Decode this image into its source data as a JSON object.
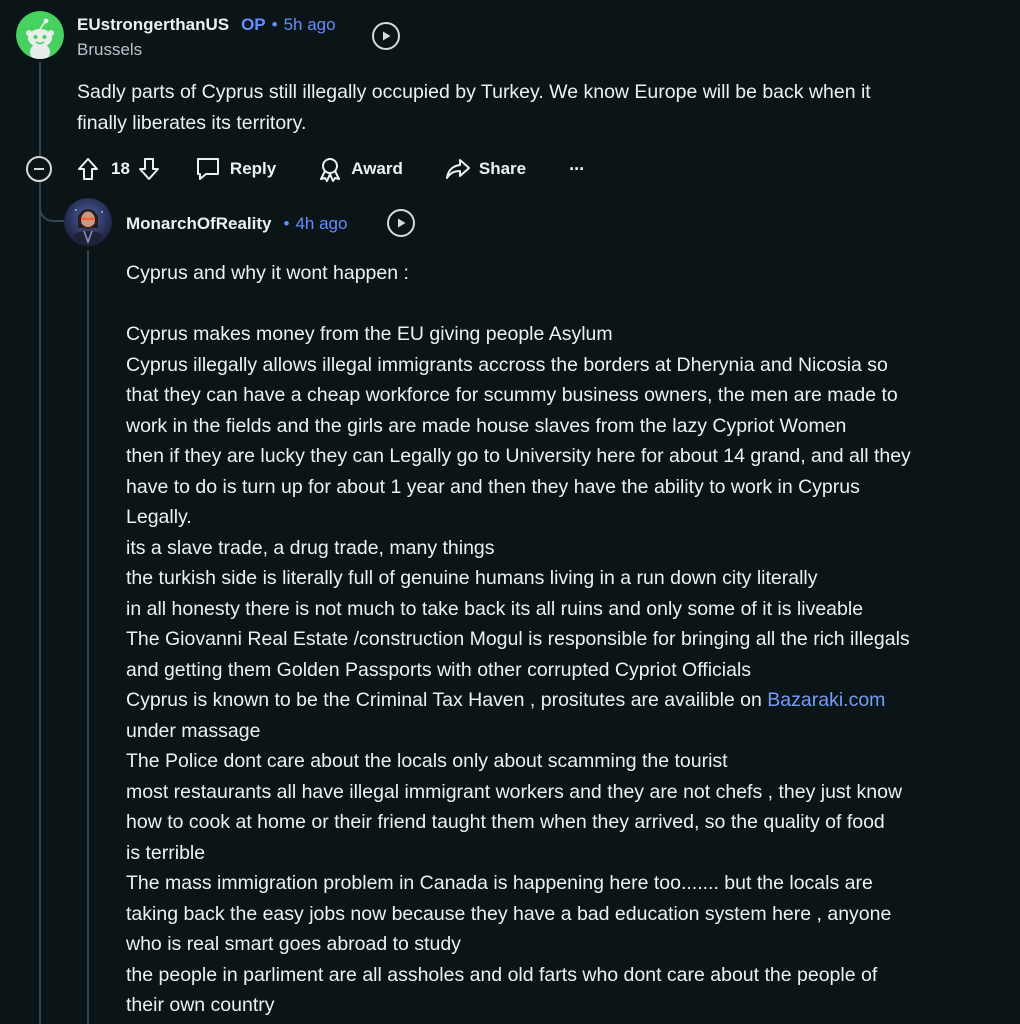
{
  "op_comment": {
    "username": "EUstrongerthanUS",
    "op_badge": "OP",
    "separator": "•",
    "time": "5h ago",
    "flair": "Brussels",
    "body": [
      "Sadly parts of Cyprus still illegally occupied by Turkey. We know Europe will be back when it",
      "finally liberates its territory."
    ]
  },
  "actions": {
    "vote_count": "18",
    "reply_label": "Reply",
    "award_label": "Award",
    "share_label": "Share",
    "more_label": "···"
  },
  "reply_comment": {
    "username": "MonarchOfReality",
    "separator": "•",
    "time": "4h ago",
    "body": {
      "intro": "Cyprus and why it wont happen :",
      "l1": "Cyprus makes money from the EU giving people Asylum",
      "l2": "Cyprus illegally allows illegal immigrants accross the borders at Dherynia and Nicosia so",
      "l3": "that they can have a cheap workforce for scummy business owners, the men are made to",
      "l4": "work in the fields and the girls are made house slaves from the lazy Cypriot Women",
      "l5": "then if they are lucky they can Legally go to University here for about 14 grand, and all they",
      "l6": "have to do is turn up for about 1 year and then they have the ability to work in Cyprus",
      "l7": "Legally.",
      "l8": "its a slave trade, a drug trade, many things",
      "l9": "the turkish side is literally full of genuine humans living in a run down city literally",
      "l10": "in all honesty there is not much to take back its all ruins and only some of it is liveable",
      "l11": "The Giovanni Real Estate /construction Mogul is responsible for bringing all the rich illegals",
      "l12": "and getting them Golden Passports with other corrupted Cypriot Officials",
      "l13_prefix": "Cyprus is known to be the Criminal Tax Haven , prositutes are availible on ",
      "l13_link": "Bazaraki.com",
      "l14": "under massage",
      "l15": "The Police dont care about the locals only about scamming the tourist",
      "l16": "most restaurants all have illegal immigrant workers and they are not chefs , they just know",
      "l17": "how to cook at home or their friend taught them when they arrived, so the quality of food",
      "l18": "is terrible",
      "l19": "The mass immigration problem in Canada is happening here too....... but the locals are",
      "l20": "taking back the easy jobs now because they have a bad education system here , anyone",
      "l21": "who is real smart goes abroad to study",
      "l22": "the people in parliment are all assholes and old farts who dont care about the people of",
      "l23": "their own country"
    }
  },
  "colors": {
    "background": "#0b1416",
    "text": "#eef1f3",
    "accent_blue": "#648efc",
    "link": "#729ffb",
    "thread_line": "#33464c",
    "op_avatar_bg": "#46d160"
  }
}
